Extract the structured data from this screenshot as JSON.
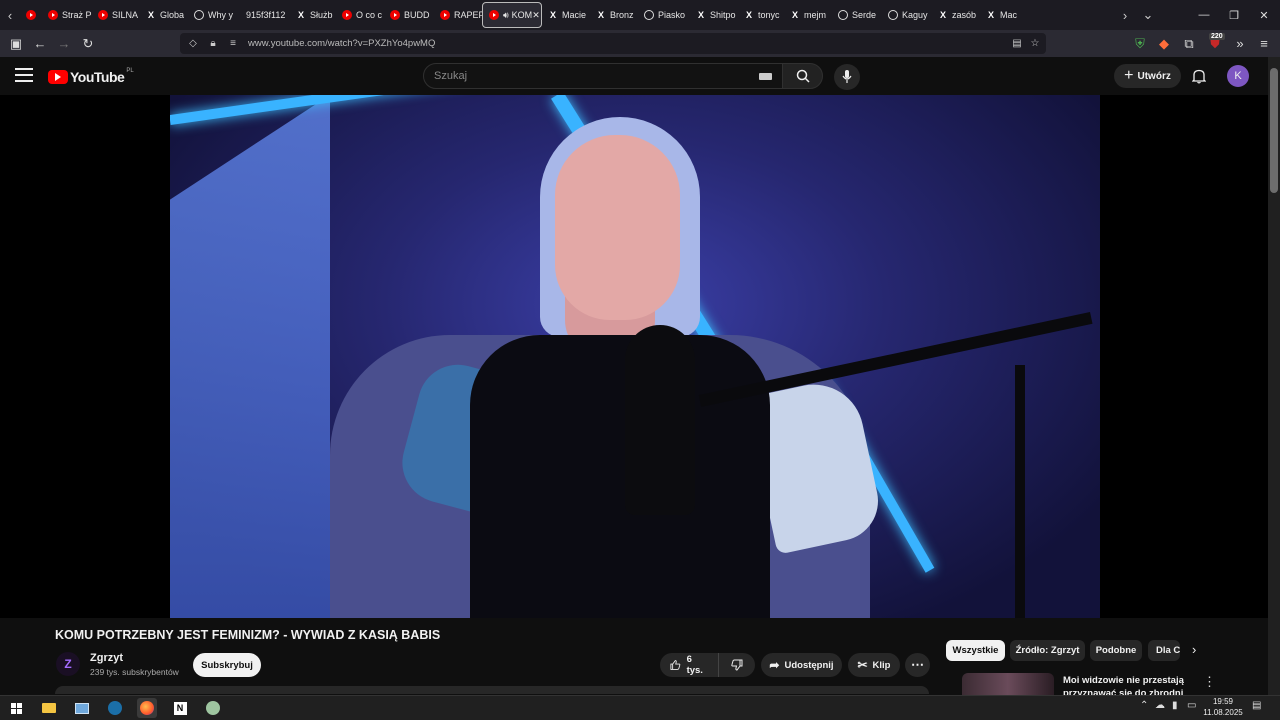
{
  "browser": {
    "tabs": [
      {
        "title": "",
        "icon": "youtube"
      },
      {
        "title": "Straż P",
        "icon": "youtube"
      },
      {
        "title": "SILNA",
        "icon": "youtube"
      },
      {
        "title": "Globa",
        "icon": "x"
      },
      {
        "title": "Why y",
        "icon": "x-thread"
      },
      {
        "title": "915f3f112",
        "icon": "none"
      },
      {
        "title": "Służb",
        "icon": "x"
      },
      {
        "title": "O co c",
        "icon": "youtube"
      },
      {
        "title": "BUDD",
        "icon": "youtube"
      },
      {
        "title": "RAPEF",
        "icon": "youtube"
      },
      {
        "title": "KOM",
        "icon": "youtube-audio",
        "active": true
      },
      {
        "title": "Macie",
        "icon": "x"
      },
      {
        "title": "Bronz",
        "icon": "x"
      },
      {
        "title": "Piasko",
        "icon": "x-thread"
      },
      {
        "title": "Shitpo",
        "icon": "x"
      },
      {
        "title": "tonyc",
        "icon": "x"
      },
      {
        "title": "mejm",
        "icon": "x"
      },
      {
        "title": "Serde",
        "icon": "x-thread"
      },
      {
        "title": "Kaguy",
        "icon": "x-thread"
      },
      {
        "title": "zasób",
        "icon": "x"
      },
      {
        "title": "Mac",
        "icon": "x"
      }
    ],
    "url": "www.youtube.com/watch?v=PXZhYo4pwMQ",
    "extension_badge": "220"
  },
  "youtube": {
    "logo_text": "YouTube",
    "region": "PL",
    "search_placeholder": "Szukaj",
    "create_label": "Utwórz",
    "avatar_letter": "K"
  },
  "video": {
    "title": "KOMU POTRZEBNY JEST FEMINIZM? - WYWIAD Z KASIĄ BABIS",
    "channel": "Zgrzyt",
    "channel_logo": "Z",
    "subscribers": "239 tys. subskrybentów",
    "subscribe_label": "Subskrybuj",
    "likes": "6 tys.",
    "share_label": "Udostępnij",
    "clip_label": "Klip"
  },
  "chips": [
    "Wszystkie",
    "Źródło: Zgrzyt",
    "Podobne",
    "Dla C"
  ],
  "recommendation": {
    "title": "Moi widzowie nie przestają przyznawać się do zbrodni"
  },
  "taskbar": {
    "time": "19:59",
    "date": "11.08.2025"
  },
  "colors": {
    "youtube_red": "#ff0000",
    "bg": "#0f0f0f",
    "avatar": "#7e57c2"
  }
}
